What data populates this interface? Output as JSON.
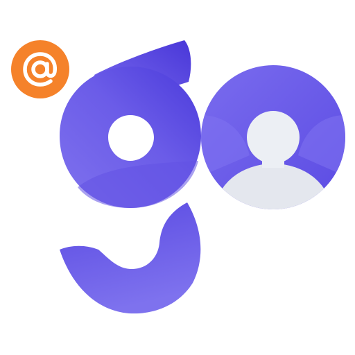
{
  "app": {
    "name": "go",
    "logo_text": "go"
  },
  "icons": {
    "logo": "go-logo-icon",
    "mention": "at-sign-icon",
    "avatar": "user-avatar-icon"
  },
  "colors": {
    "brand_purple_light": "#7c6ef0",
    "brand_purple": "#6a5ae6",
    "brand_purple_dark": "#4f3fdc",
    "badge_orange": "#f5822a",
    "avatar_person": "#eceff4",
    "background": "#ffffff"
  }
}
